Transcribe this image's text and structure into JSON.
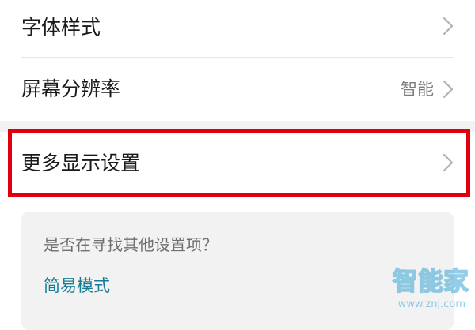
{
  "settings": {
    "items": [
      {
        "label": "字体样式",
        "value": ""
      },
      {
        "label": "屏幕分辨率",
        "value": "智能"
      },
      {
        "label": "更多显示设置",
        "value": ""
      }
    ]
  },
  "suggestion_card": {
    "question": "是否在寻找其他设置项？",
    "link": "简易模式"
  },
  "watermark": {
    "main": "智能家",
    "sub": "www.znj.com"
  },
  "colors": {
    "highlight_border": "#e0000d",
    "link": "#167c96",
    "section_gap": "#f2f2f2"
  },
  "icons": {
    "chevron": "chevron-right-icon"
  }
}
